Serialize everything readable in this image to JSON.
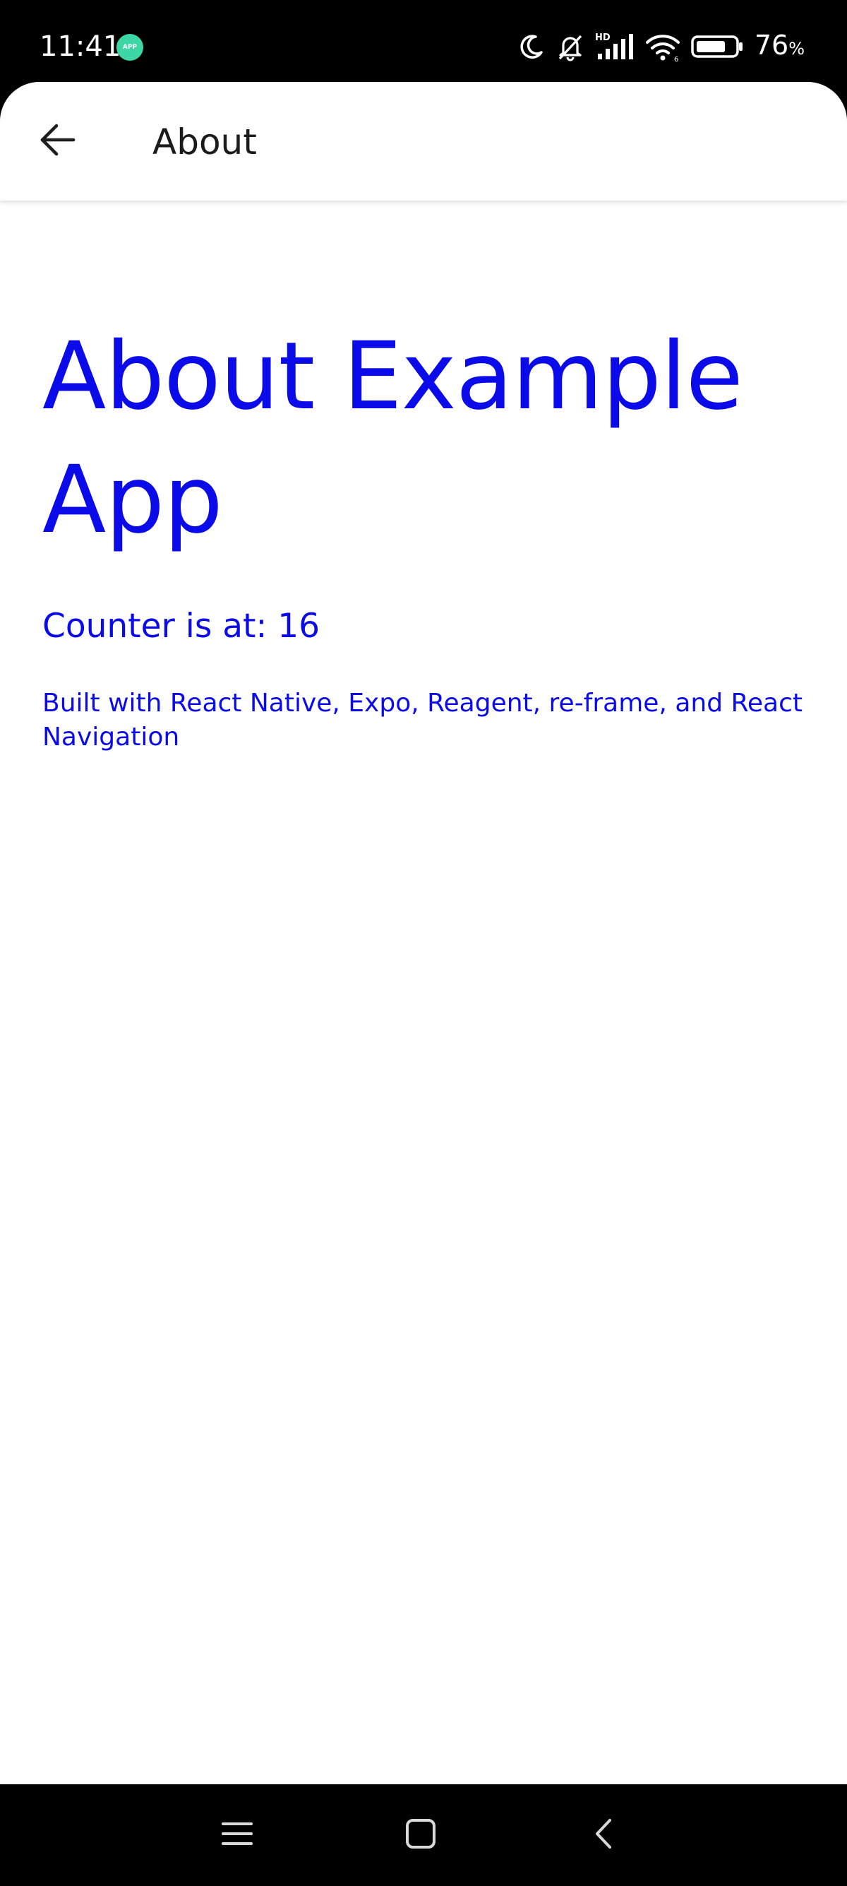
{
  "status_bar": {
    "time": "11:41",
    "app_badge": "APP",
    "battery_level": "76",
    "battery_unit": "%",
    "battery_fill_fraction": 0.76,
    "icons": [
      "moon-icon",
      "bell-off-icon",
      "hd-signal-icon",
      "wifi-icon",
      "battery-icon"
    ]
  },
  "header": {
    "title": "About",
    "back_icon": "arrow-left-icon"
  },
  "main": {
    "title": "About Example App",
    "counter_text": "Counter is at: 16",
    "built_with": "Built with React Native, Expo, Reagent, re-frame, and React Navigation"
  },
  "nav_bar": {
    "icons": [
      "menu-icon",
      "home-square-icon",
      "back-chevron-icon"
    ]
  },
  "colors": {
    "accent_text": "#0b0bea",
    "header_text": "#1c1c1c",
    "badge": "#3dd6a5"
  }
}
